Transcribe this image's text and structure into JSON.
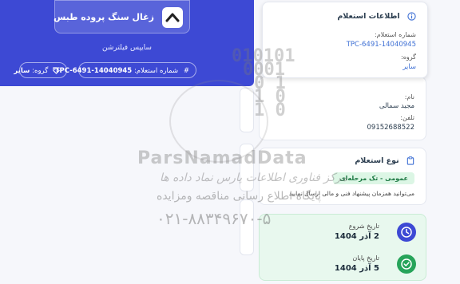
{
  "company": {
    "name": "زغال سنگ پروده طبس",
    "subtitle": "سایپس فیلترشن"
  },
  "chips": {
    "tender_label": "شماره استعلام:",
    "tender_value": "TPC-6491-14040945",
    "group_label": "گروه:",
    "group_value": "سایر"
  },
  "info_card": {
    "title": "اطلاعات استعلام",
    "tender_no_label": "شماره استعلام:",
    "tender_no_value": "TPC-6491-14040945",
    "group_label": "گروه:",
    "group_value": "سایر"
  },
  "contact_card": {
    "name_label": "نام:",
    "name_value": "مجید سمالی",
    "phone_label": "تلفن:",
    "phone_value": "09152688522"
  },
  "type_card": {
    "title": "نوع استعلام",
    "badge": "عمومی - تک مرحله‌ای",
    "note": "می‌توانید همزمان پیشنهاد فنی و مالی ارسال نمایید"
  },
  "dates": {
    "start_label": "تاریخ شروع",
    "start_value": "2 آذر 1404",
    "end_label": "تاریخ پایان",
    "end_value": "5 آذر 1404"
  },
  "watermark": {
    "digits": [
      "010101",
      "0001",
      "0  1",
      "1  0",
      "1  0"
    ],
    "brand": "ParsNamadData",
    "line1": "مرکز فناوری اطلاعات پارس نماد داده ها",
    "line2": "پایگاه اطلاع رسانی مناقصه ومزایده",
    "line3": "۰۲۱-۸۸۳۴۹۶۷۰-۵"
  },
  "colors": {
    "accent": "#3d49d4",
    "link": "#3d6fd4",
    "success": "#27a45a",
    "date_bg": "#e8f8ee"
  }
}
